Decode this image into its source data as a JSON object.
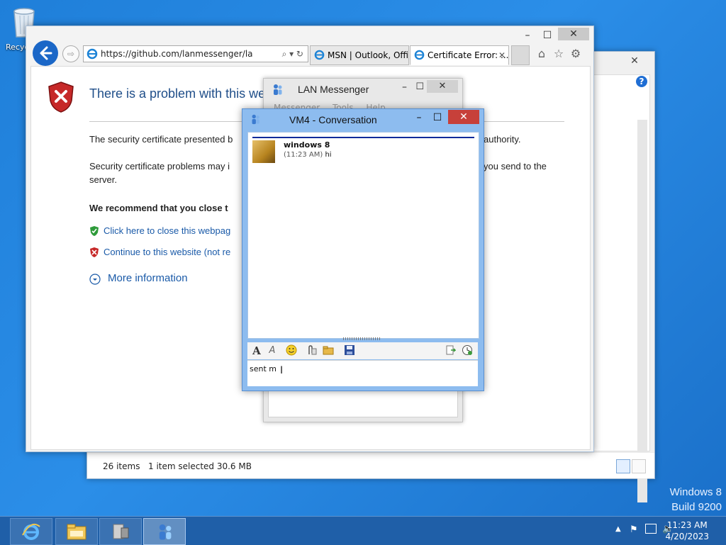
{
  "desktop": {
    "recycle_bin_label": "Recyc",
    "watermark_line1": "Windows 8",
    "watermark_line2": "Build 9200"
  },
  "explorer": {
    "status_items": "26 items",
    "status_selected": "1 item selected  30.6 MB",
    "help_label": "?"
  },
  "browser": {
    "address_url": "https://github.com/lanmessenger/lanmesse",
    "address_controls": "⌕ ▾ ↻",
    "tabs": [
      {
        "label": "MSN | Outlook, Offi...",
        "active": false
      },
      {
        "label": "Certificate Error: ...",
        "active": true,
        "close": "✕"
      }
    ],
    "page": {
      "title": "There is a problem with this web",
      "line1": "The security certificate presented b",
      "line1_end": "authority.",
      "line2": "Security certificate problems may i",
      "line2_end": "you send to the",
      "line2_cont": "server.",
      "recommend": "We recommend that you close t",
      "link_close": "Click here to close this webpag",
      "link_continue": "Continue to this website (not re",
      "more_info": "More information"
    }
  },
  "lan_messenger": {
    "title": "LAN Messenger",
    "menu": [
      "Messenger",
      "Tools",
      "Help"
    ]
  },
  "conversation": {
    "title": "VM4 - Conversation",
    "message": {
      "sender": "windows 8",
      "time": "(11:23 AM)",
      "text": "hi"
    },
    "input_text": "sent m"
  },
  "taskbar": {
    "clock_time": "11:23 AM",
    "clock_date": "4/20/2023"
  },
  "colors": {
    "desktop": "#1f7fd9",
    "taskbar": "#1f5fa8",
    "accent_link": "#1a5aa8",
    "close_red": "#c7403a"
  }
}
